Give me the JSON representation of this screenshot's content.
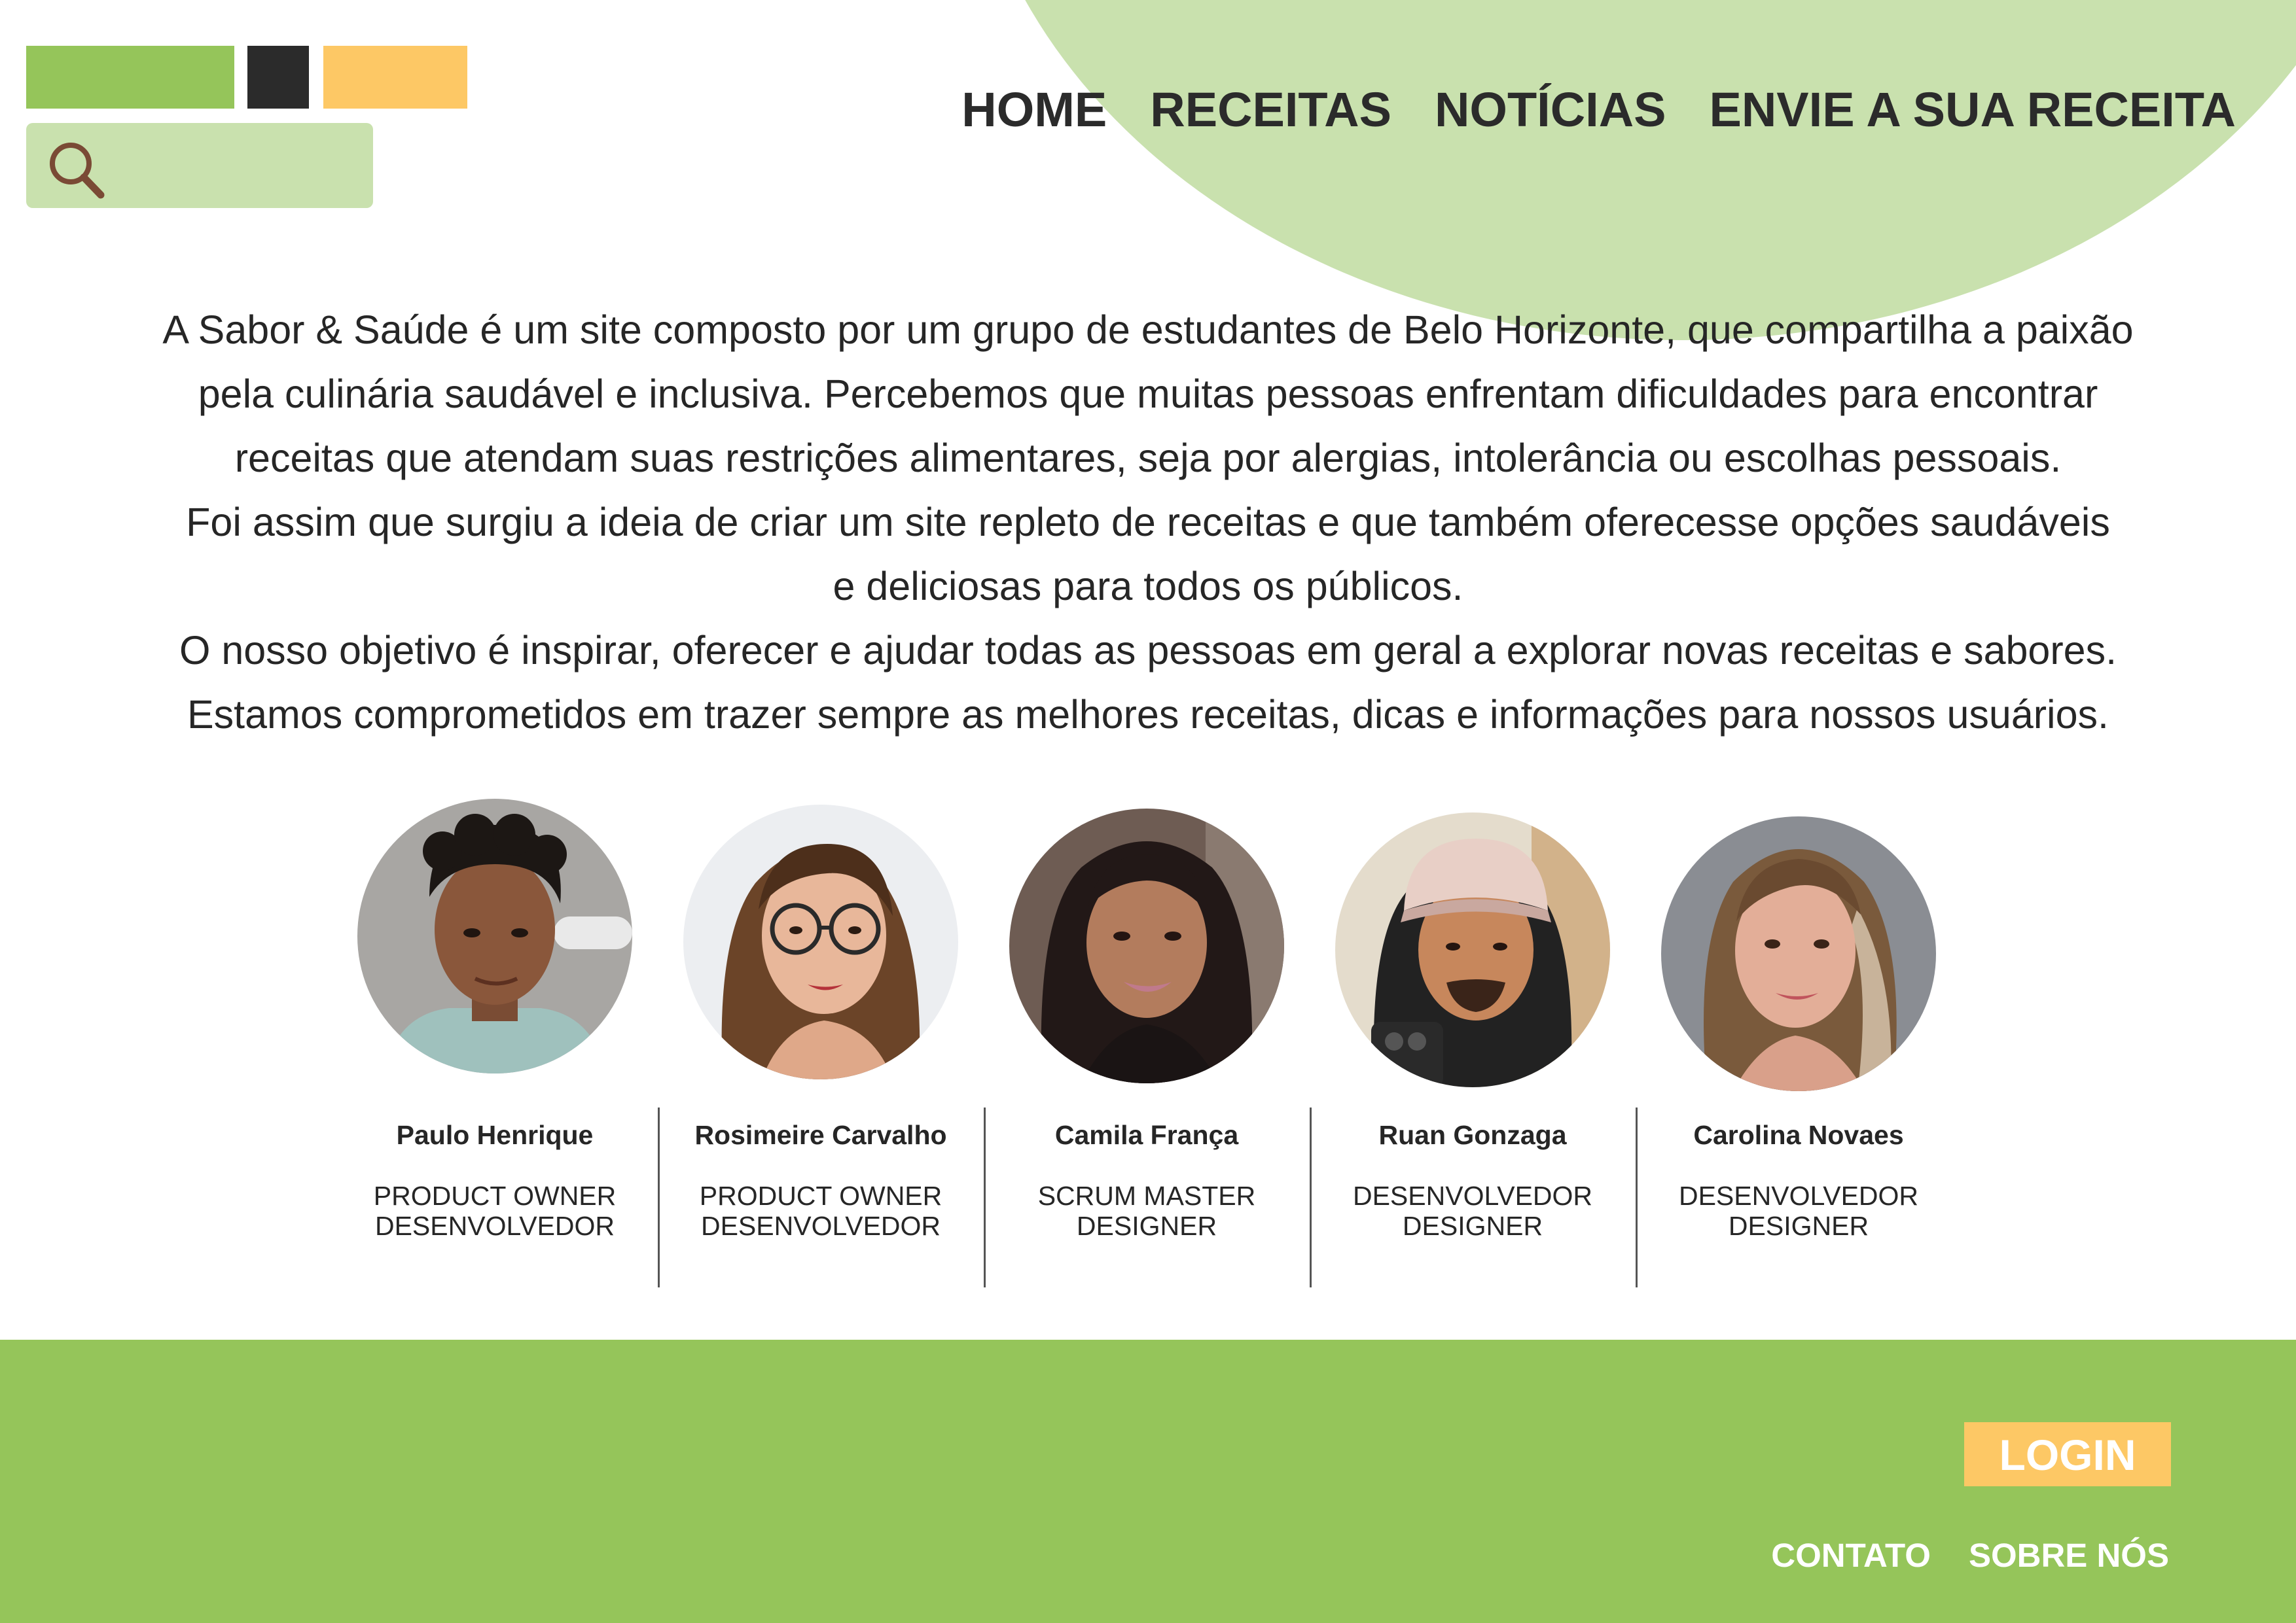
{
  "colors": {
    "brand_green": "#95c55a",
    "light_green": "#c9e1ae",
    "dark": "#2b2b2b",
    "accent_yellow": "#fdc865",
    "text": "#262626"
  },
  "header": {
    "search": {
      "icon": "search-icon",
      "placeholder": ""
    },
    "nav": [
      {
        "label": "HOME"
      },
      {
        "label": "RECEITAS"
      },
      {
        "label": "NOTÍCIAS"
      },
      {
        "label": "ENVIE A SUA RECEITA"
      }
    ]
  },
  "intro": {
    "lines": [
      "A Sabor & Saúde é um site composto por um grupo de estudantes de Belo Horizonte, que compartilha a paixão",
      "pela culinária saudável e inclusiva. Percebemos que muitas pessoas enfrentam dificuldades para encontrar",
      "receitas que atendam suas restrições alimentares, seja por alergias, intolerância ou escolhas pessoais.",
      "Foi assim que surgiu a ideia de criar um site repleto de receitas e que também oferecesse opções saudáveis",
      "e deliciosas para todos os públicos.",
      "O nosso objetivo é inspirar, oferecer e ajudar todas as pessoas em geral a explorar novas receitas e sabores.",
      "Estamos comprometidos em trazer sempre as melhores receitas, dicas e informações para nossos usuários."
    ]
  },
  "team": [
    {
      "name": "Paulo Henrique",
      "role_line1": "PRODUCT OWNER",
      "role_line2": "DESENVOLVEDOR"
    },
    {
      "name": "Rosimeire Carvalho",
      "role_line1": "PRODUCT OWNER",
      "role_line2": "DESENVOLVEDOR"
    },
    {
      "name": "Camila França",
      "role_line1": "SCRUM MASTER",
      "role_line2": "DESIGNER"
    },
    {
      "name": "Ruan Gonzaga",
      "role_line1": "DESENVOLVEDOR",
      "role_line2": "DESIGNER"
    },
    {
      "name": "Carolina Novaes",
      "role_line1": "DESENVOLVEDOR",
      "role_line2": "DESIGNER"
    }
  ],
  "footer": {
    "login_label": "LOGIN",
    "links": [
      {
        "label": "CONTATO"
      },
      {
        "label": "SOBRE NÓS"
      }
    ]
  }
}
